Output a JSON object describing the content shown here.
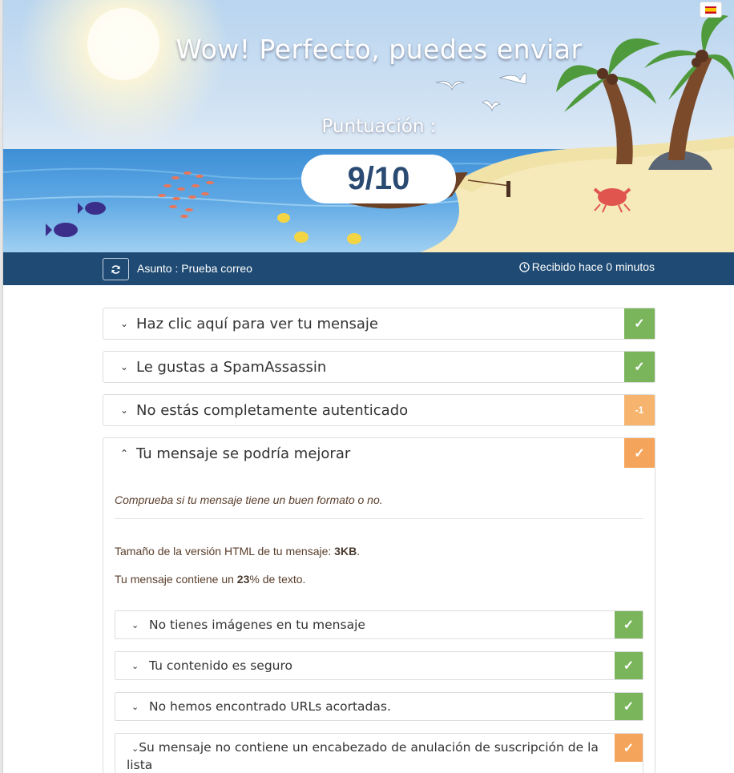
{
  "language_flag": "es",
  "hero": {
    "title": "Wow! Perfecto, puedes enviar",
    "score_label": "Puntuación :",
    "score": "9/10"
  },
  "bar": {
    "subject_label": "Asunto : Prueba correo",
    "received": "Recibido hace 0 minutos"
  },
  "panels": [
    {
      "label": "Haz clic aquí para ver tu mensaje",
      "status": "ok",
      "badge": "✓"
    },
    {
      "label": "Le gustas a SpamAssassin",
      "status": "ok",
      "badge": "✓"
    },
    {
      "label": "No estás completamente autenticado",
      "status": "warn",
      "badge": "-1"
    },
    {
      "label": "Tu mensaje se podría mejorar",
      "status": "warn",
      "badge": "✓"
    }
  ],
  "open_panel": {
    "intro": "Comprueba si tu mensaje tiene un buen formato o no.",
    "html_size_prefix": "Tamaño de la versión HTML de tu mensaje: ",
    "html_size_value": "3KB",
    "html_size_suffix": ".",
    "text_prefix": "Tu mensaje contiene un ",
    "text_value": "23",
    "text_suffix": "% de texto."
  },
  "sub_checks": [
    {
      "label": "No tienes imágenes en tu mensaje",
      "status": "ok",
      "badge": "✓"
    },
    {
      "label": "Tu contenido es seguro",
      "status": "ok",
      "badge": "✓"
    },
    {
      "label": "No hemos encontrado URLs acortadas.",
      "status": "ok",
      "badge": "✓"
    },
    {
      "label": "Su mensaje no contiene un encabezado de anulación de suscripción de la lista",
      "status": "warn",
      "badge": "✓"
    }
  ],
  "colors": {
    "ok": "#7ab55c",
    "warn": "#f5a55b",
    "bar": "#1e4a73",
    "score": "#2a4a72"
  },
  "icons": [
    "refresh-icon",
    "clock-icon",
    "chevron-down-icon",
    "chevron-up-icon",
    "check-icon"
  ]
}
